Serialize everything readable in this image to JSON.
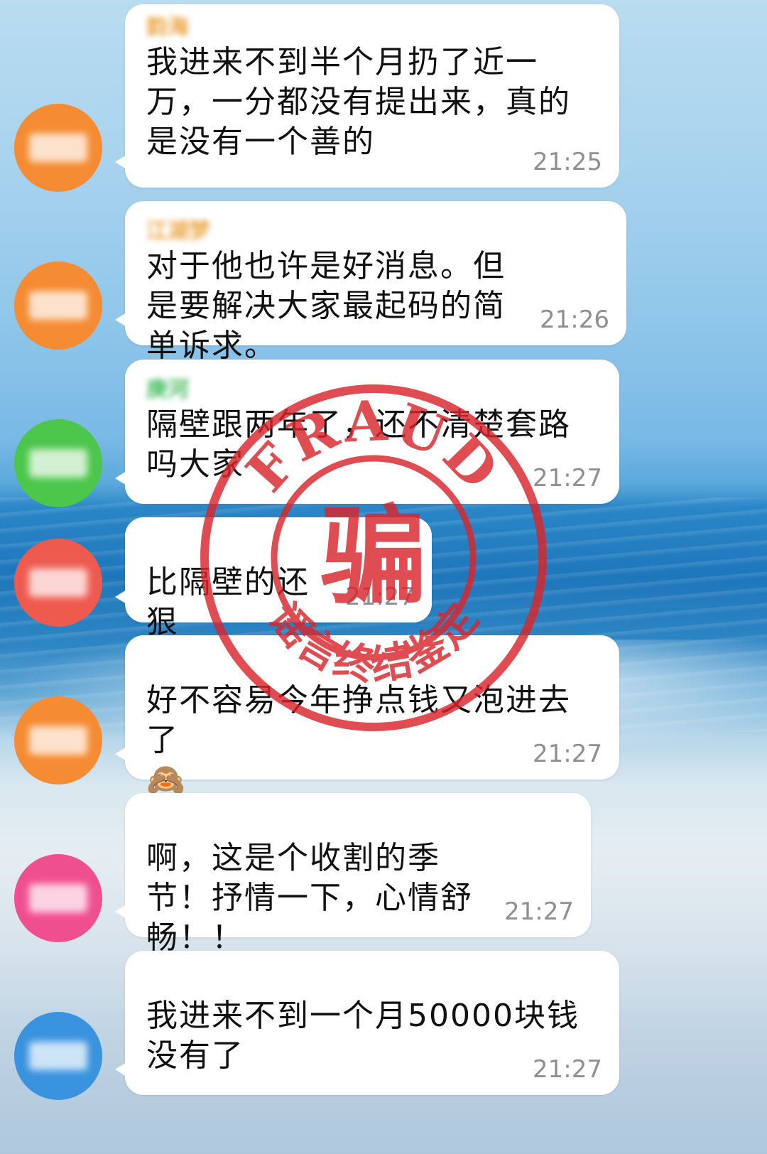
{
  "colors": {
    "stamp_red": "#d8262b",
    "time_gray": "#8f8f8f",
    "bubble_bg": "#ffffff"
  },
  "messages": [
    {
      "sender": "韵海",
      "sender_color": "#e89a2b",
      "avatar_color": "#f58b32",
      "text": "我进来不到半个月扔了近一万，一分都没有提出来，真的是没有一个善的",
      "time": "21:25"
    },
    {
      "sender": "江湖梦",
      "sender_color": "#e89a2b",
      "avatar_color": "#f58b32",
      "text": "对于他也许是好消息。但是要解决大家最起码的简单诉求。",
      "time": "21:26"
    },
    {
      "sender": "庚河",
      "sender_color": "#2fb24a",
      "avatar_color": "#4cc64b",
      "text": "隔壁跟两年了，还不清楚套路吗大家",
      "time": "21:27"
    },
    {
      "sender": "",
      "sender_color": "#e07a7a",
      "avatar_color": "#ef5a4f",
      "text": "比隔壁的还狠",
      "time": "21:27"
    },
    {
      "sender": "",
      "sender_color": "#e6a36a",
      "avatar_color": "#f58b32",
      "text": "好不容易今年挣点钱又泡进去了",
      "emoji": "🙈",
      "time": "21:27"
    },
    {
      "sender": "",
      "sender_color": "#6ab6e6",
      "avatar_color": "#f04f8f",
      "text": "啊，这是个收割的季节！抒情一下，心情舒畅！！",
      "time": "21:27"
    },
    {
      "sender": "",
      "sender_color": "#9fd6e0",
      "avatar_color": "#3a93de",
      "text": "我进来不到一个月50000块钱没有了",
      "time": "21:27"
    }
  ],
  "stamp": {
    "top_text": "FRAUD",
    "center_text": "骗",
    "bottom_text": "谣言终结鉴定"
  }
}
